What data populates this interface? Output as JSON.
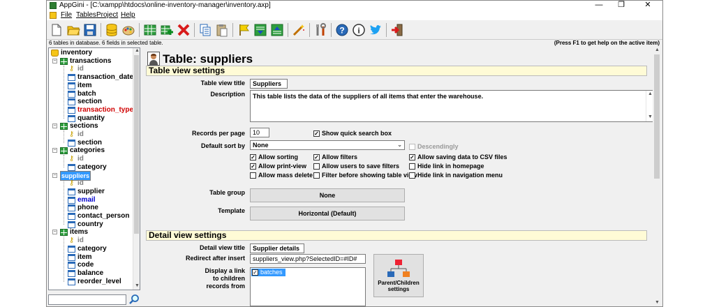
{
  "titlebar": {
    "title": "AppGini - [C:\\xampp\\htdocs\\online-inventory-manager\\inventory.axp]",
    "minimize": "—",
    "restore": "❐",
    "close": "✕"
  },
  "menu": [
    "File",
    "Tables",
    "Project",
    "Help"
  ],
  "toolbar_icons": [
    "new-project-icon",
    "open-project-icon",
    "save-project-icon",
    "database-icon",
    "theme-palette-icon",
    "add-table-icon",
    "add-field-icon",
    "delete-icon",
    "copy-icon",
    "paste-icon",
    "highlight-icon",
    "move-down-icon",
    "move-up-icon",
    "magic-wand-icon",
    "tools-icon",
    "help-icon",
    "info-icon",
    "twitter-icon",
    "exit-icon"
  ],
  "status": {
    "left": "6 tables in database. 6 fields in selected table.",
    "right": "(Press F1 to get help on the active item)"
  },
  "tree": {
    "root": "inventory",
    "tables": [
      {
        "name": "transactions",
        "fields": [
          {
            "name": "id",
            "key": true
          },
          {
            "name": "transaction_date"
          },
          {
            "name": "item"
          },
          {
            "name": "batch"
          },
          {
            "name": "section"
          },
          {
            "name": "transaction_type",
            "color": "red"
          },
          {
            "name": "quantity"
          }
        ]
      },
      {
        "name": "sections",
        "fields": [
          {
            "name": "id",
            "key": true
          },
          {
            "name": "section"
          }
        ]
      },
      {
        "name": "categories",
        "fields": [
          {
            "name": "id",
            "key": true
          },
          {
            "name": "category"
          }
        ]
      },
      {
        "name": "suppliers",
        "selected": true,
        "fields": [
          {
            "name": "id",
            "key": true
          },
          {
            "name": "supplier"
          },
          {
            "name": "email",
            "color": "blue"
          },
          {
            "name": "phone"
          },
          {
            "name": "contact_person"
          },
          {
            "name": "country"
          }
        ]
      },
      {
        "name": "items",
        "fields": [
          {
            "name": "id",
            "key": true
          },
          {
            "name": "category"
          },
          {
            "name": "item"
          },
          {
            "name": "code"
          },
          {
            "name": "balance"
          },
          {
            "name": "reorder_level"
          }
        ]
      }
    ]
  },
  "main": {
    "heading": "Table: suppliers",
    "table_view": {
      "section_title": "Table view settings",
      "title_label": "Table view title",
      "title_value": "Suppliers",
      "description_label": "Description",
      "description_value": "This table lists the data of the suppliers of all items that enter the warehouse.",
      "records_label": "Records per page",
      "records_value": "10",
      "quick_search": "Show quick search box",
      "sort_label": "Default sort by",
      "sort_value": "None",
      "descending": "Descendingly",
      "checks": {
        "allow_sorting": "Allow sorting",
        "allow_print": "Allow print-view",
        "allow_mass_delete": "Allow mass delete",
        "allow_filters": "Allow filters",
        "users_save_filters": "Allow users to save filters",
        "filter_before": "Filter before showing table view",
        "csv": "Allow saving data to CSV files",
        "hide_homepage": "Hide link in homepage",
        "hide_nav": "Hide link in navigation menu"
      },
      "group_label": "Table group",
      "group_value": "None",
      "template_label": "Template",
      "template_value": "Horizontal (Default)"
    },
    "detail_view": {
      "section_title": "Detail view settings",
      "title_label": "Detail view title",
      "title_value": "Supplier details",
      "redirect_label": "Redirect after insert",
      "redirect_value": "suppliers_view.php?SelectedID=#ID#",
      "children_label_1": "Display a link",
      "children_label_2": "to children",
      "children_label_3": "records from",
      "children_item": "batches",
      "parent_children_1": "Parent/Children",
      "parent_children_2": "settings"
    }
  }
}
